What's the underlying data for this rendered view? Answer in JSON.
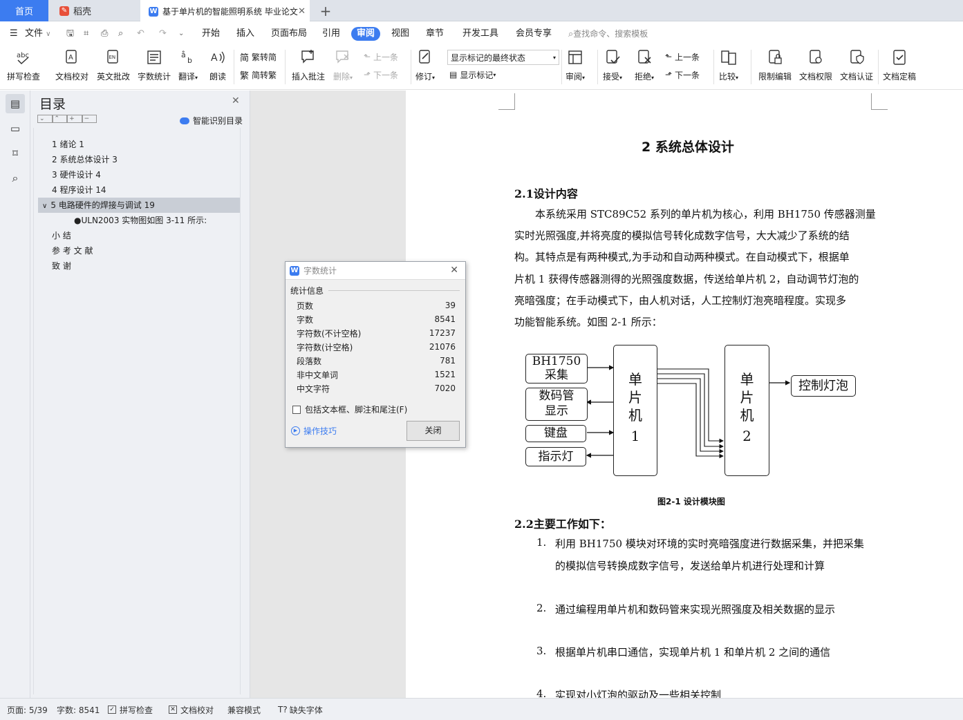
{
  "tabs": {
    "home": "首页",
    "daoke": "稻壳",
    "doc": "基于单片机的智能照明系统 毕业论文"
  },
  "menu": {
    "file": "文件",
    "items": [
      "开始",
      "插入",
      "页面布局",
      "引用",
      "审阅",
      "视图",
      "章节",
      "开发工具",
      "会员专享"
    ],
    "search": "查找命令、搜索模板"
  },
  "ribbon": {
    "spell": "拼写检查",
    "proof": "文档校对",
    "en_review": "英文批改",
    "wordcount": "字数统计",
    "translate": "翻译",
    "read": "朗读",
    "trad": "繁转简",
    "simp": "简转繁",
    "add_comment": "插入批注",
    "delete": "删除",
    "prev_c": "上一条",
    "next_c": "下一条",
    "track": "修订",
    "markup_state": "显示标记的最终状态",
    "show_markup": "显示标记",
    "review": "审阅",
    "accept": "接受",
    "reject": "拒绝",
    "prev": "上一条",
    "next": "下一条",
    "compare": "比较",
    "restrict": "限制编辑",
    "perm": "文档权限",
    "cert": "文档认证",
    "final": "文档定稿"
  },
  "toc": {
    "title": "目录",
    "smart": "智能识别目录",
    "items": [
      "1  绪论  1",
      "2  系统总体设计  3",
      "3  硬件设计  4",
      "4  程序设计  14",
      "5  电路硬件的焊接与调试  19",
      "●ULN2003 实物图如图 3-11 所示:",
      "小  结",
      "参  考  文  献",
      "致    谢"
    ]
  },
  "dialog": {
    "title": "字数统计",
    "section": "统计信息",
    "rows": [
      {
        "label": "页数",
        "value": "39"
      },
      {
        "label": "字数",
        "value": "8541"
      },
      {
        "label": "字符数(不计空格)",
        "value": "17237"
      },
      {
        "label": "字符数(计空格)",
        "value": "21076"
      },
      {
        "label": "段落数",
        "value": "781"
      },
      {
        "label": "非中文单词",
        "value": "1521"
      },
      {
        "label": "中文字符",
        "value": "7020"
      }
    ],
    "checkbox": "包括文本框、脚注和尾注(F)",
    "tips": "操作技巧",
    "close": "关闭"
  },
  "doc": {
    "heading": "2  系统总体设计",
    "sec21": "2.1设计内容",
    "para": [
      "本系统采用 STC89C52 系列的单片机为核心，利用 BH1750 传感器测量",
      "实时光照强度,并将亮度的模拟信号转化成数字信号，大大减少了系统的结",
      "构。其特点是有两种模式,为手动和自动两种模式。在自动模式下，根据单",
      "片机 1 获得传感器测得的光照强度数据，传送给单片机 2，自动调节灯泡的",
      "亮暗强度；在手动模式下，由人机对话，人工控制灯泡亮暗程度。实现多",
      "功能智能系统。如图 2-1 所示："
    ],
    "diagram": {
      "bh1": "BH1750",
      "bh2": "采集",
      "seg1": "数码管",
      "seg2": "显示",
      "key": "键盘",
      "led": "指示灯",
      "mcu1": [
        "单",
        "片",
        "机",
        "1"
      ],
      "mcu2": [
        "单",
        "片",
        "机",
        "2"
      ],
      "lamp": "控制灯泡"
    },
    "caption": "图2-1 设计模块图",
    "sec22": "2.2主要工作如下：",
    "list": [
      {
        "num": "1.",
        "lines": [
          "利用 BH1750 模块对环境的实时亮暗强度进行数据采集，并把采集",
          "的模拟信号转换成数字信号，发送给单片机进行处理和计算"
        ]
      },
      {
        "num": "2.",
        "lines": [
          "通过编程用单片机和数码管来实现光照强度及相关数据的显示"
        ]
      },
      {
        "num": "3.",
        "lines": [
          "根据单片机串口通信，实现单片机 1 和单片机 2 之间的通信"
        ]
      },
      {
        "num": "4.",
        "lines": [
          "实现对小灯泡的驱动及一些相关控制"
        ]
      }
    ]
  },
  "status": {
    "page": "页面: 5/39",
    "words": "字数: 8541",
    "spell": "拼写检查",
    "proof": "文档校对",
    "compat": "兼容模式",
    "font": "缺失字体"
  },
  "colors": {
    "accent": "#3c7cf0",
    "toc_selected": "#c9ced6"
  }
}
